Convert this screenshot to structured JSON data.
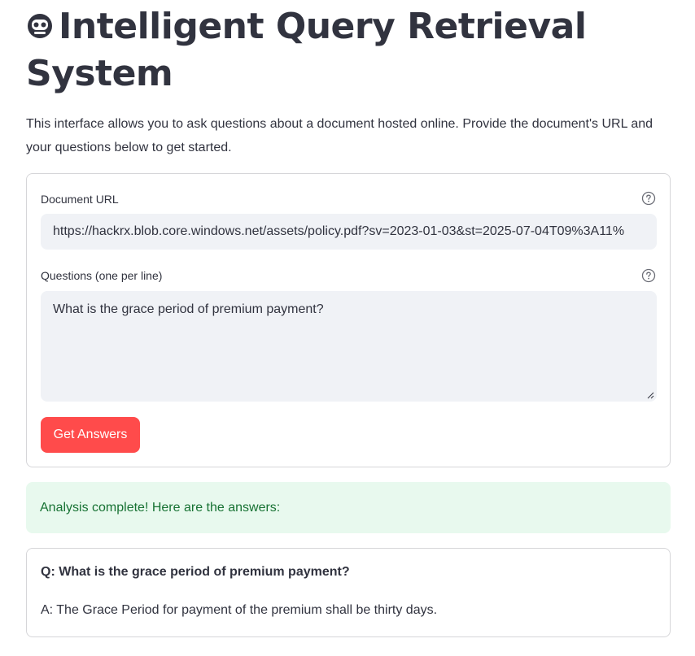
{
  "header": {
    "title": "Intelligent Query Retrieval System",
    "title_icon": "robot-face-icon"
  },
  "intro": "This interface allows you to ask questions about a document hosted online. Provide the document's URL and your questions below to get started.",
  "form": {
    "url_label": "Document URL",
    "url_value": "https://hackrx.blob.core.windows.net/assets/policy.pdf?sv=2023-01-03&st=2025-07-04T09%3A11%",
    "questions_label": "Questions (one per line)",
    "questions_value": "What is the grace period of premium payment?",
    "submit_label": "Get Answers",
    "help_icon": "question-circle-icon"
  },
  "status": {
    "message": "Analysis complete! Here are the answers:"
  },
  "answers": [
    {
      "question": "Q: What is the grace period of premium payment?",
      "answer": "A: The Grace Period for payment of the premium shall be thirty days."
    }
  ],
  "colors": {
    "primary": "#ff4b4b",
    "success_bg": "#e8f9ee",
    "success_text": "#177233",
    "input_bg": "#f0f2f6",
    "text": "#31333f",
    "border": "#d6d6d9"
  }
}
